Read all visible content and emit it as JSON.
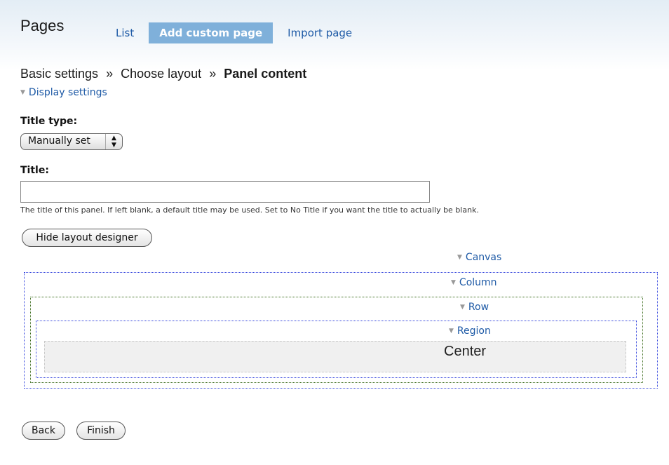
{
  "header": {
    "title": "Pages",
    "tabs": [
      {
        "label": "List"
      },
      {
        "label": "Add custom page"
      },
      {
        "label": "Import page"
      }
    ]
  },
  "breadcrumb": {
    "step1": "Basic settings",
    "sep": "»",
    "step2": "Choose layout",
    "current": "Panel content"
  },
  "display_settings": {
    "label": "Display settings"
  },
  "form": {
    "title_type_label": "Title type:",
    "title_type_value": "Manually set",
    "title_label": "Title:",
    "title_value": "",
    "title_description": "The title of this panel. If left blank, a default title may be used. Set to No Title if you want the title to actually be blank."
  },
  "designer": {
    "toggle_label": "Hide layout designer",
    "canvas_label": "Canvas",
    "column_label": "Column",
    "row_label": "Row",
    "region_label": "Region",
    "center_label": "Center"
  },
  "actions": {
    "back_label": "Back",
    "finish_label": "Finish"
  }
}
